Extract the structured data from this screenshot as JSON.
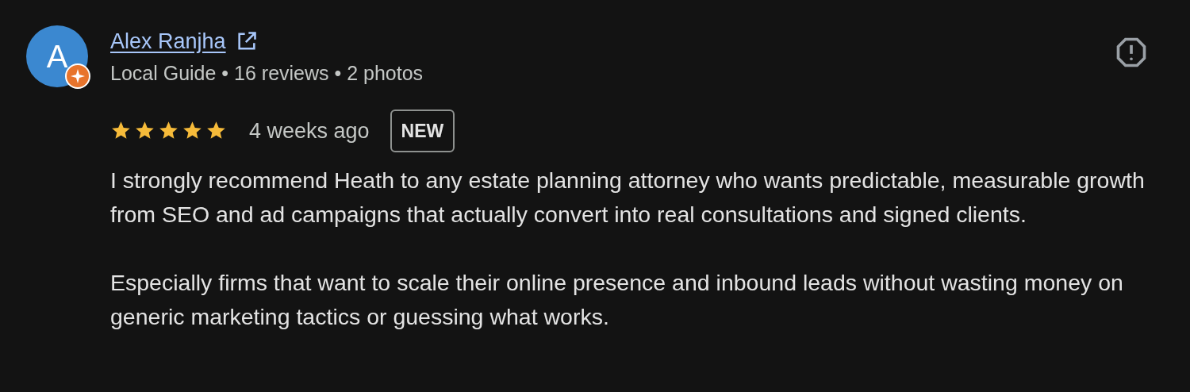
{
  "review": {
    "avatar_letter": "A",
    "author": "Alex Ranjha",
    "meta": "Local Guide • 16 reviews • 2 photos",
    "stars": 5,
    "time": "4 weeks ago",
    "badge": "NEW",
    "paragraphs": [
      "I strongly recommend Heath to any estate planning attorney who wants predictable, measurable growth from SEO and ad campaigns that actually convert into real consultations and signed clients.",
      "Especially firms that want to scale their online presence and inbound leads without wasting money on generic marketing tactics or guessing what works."
    ]
  }
}
